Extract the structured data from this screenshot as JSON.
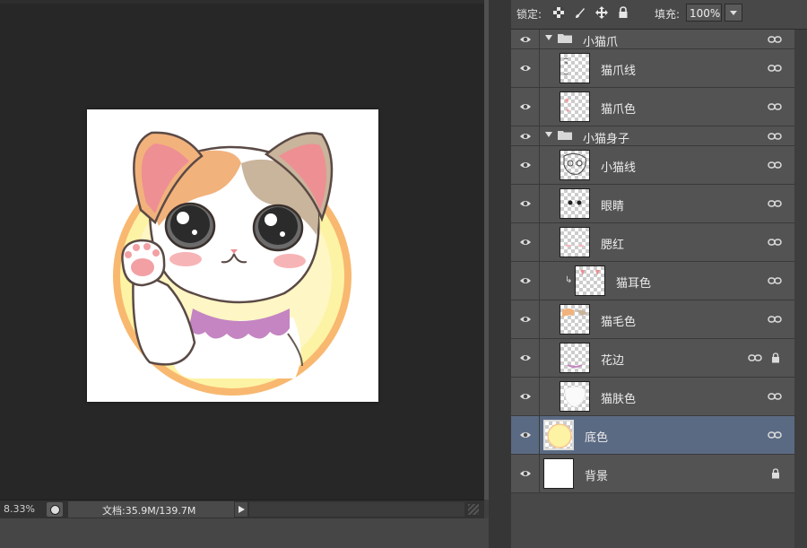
{
  "document": {
    "zoom": "8.33%",
    "doc_info": "文档:35.9M/139.7M"
  },
  "layers_panel": {
    "lock_label": "锁定:",
    "lock_icons": [
      "lock-transparent-pixels-icon",
      "lock-image-pixels-icon",
      "lock-position-icon",
      "lock-all-icon"
    ],
    "fill_label": "填充:",
    "fill_value": "100%",
    "layers": [
      {
        "name": "小猫爪",
        "type": "group",
        "expanded": true,
        "indent": 0,
        "linked": true,
        "locked": false,
        "visible": true
      },
      {
        "name": "猫爪线",
        "type": "layer",
        "indent": 1,
        "linked": true,
        "locked": false,
        "visible": true,
        "thumb": "paw-lines"
      },
      {
        "name": "猫爪色",
        "type": "layer",
        "indent": 1,
        "linked": true,
        "locked": false,
        "visible": true,
        "thumb": "paw-color"
      },
      {
        "name": "小猫身子",
        "type": "group",
        "expanded": true,
        "indent": 0,
        "linked": true,
        "locked": false,
        "visible": true
      },
      {
        "name": "小猫线",
        "type": "layer",
        "indent": 1,
        "linked": true,
        "locked": false,
        "visible": true,
        "thumb": "cat-lines"
      },
      {
        "name": "眼睛",
        "type": "layer",
        "indent": 1,
        "linked": true,
        "locked": false,
        "visible": true,
        "thumb": "eyes"
      },
      {
        "name": "腮红",
        "type": "layer",
        "indent": 1,
        "linked": true,
        "locked": false,
        "visible": true,
        "thumb": "blush"
      },
      {
        "name": "猫耳色",
        "type": "layer",
        "indent": 2,
        "clipped": true,
        "linked": true,
        "locked": false,
        "visible": true,
        "thumb": "ear-color"
      },
      {
        "name": "猫毛色",
        "type": "layer",
        "indent": 1,
        "linked": true,
        "locked": false,
        "visible": true,
        "thumb": "fur-color"
      },
      {
        "name": "花边",
        "type": "layer",
        "indent": 1,
        "linked": true,
        "locked": true,
        "visible": true,
        "thumb": "lace"
      },
      {
        "name": "猫肤色",
        "type": "layer",
        "indent": 1,
        "linked": true,
        "locked": false,
        "visible": true,
        "thumb": "skin"
      },
      {
        "name": "底色",
        "type": "layer",
        "indent": 0,
        "linked": true,
        "locked": false,
        "visible": true,
        "selected": true,
        "thumb": "base-circle"
      },
      {
        "name": "背景",
        "type": "layer",
        "indent": 0,
        "linked": false,
        "locked": true,
        "visible": true,
        "thumb": "white"
      }
    ]
  },
  "colors": {
    "selected_row": "#5b6a83",
    "circle_fill": "#fdf3a4",
    "circle_ring": "#f8b870",
    "cat_orange": "#f2b27c",
    "cat_gray": "#c9b49c",
    "ear_pink": "#ee8f93",
    "collar_purple": "#c485c2"
  }
}
